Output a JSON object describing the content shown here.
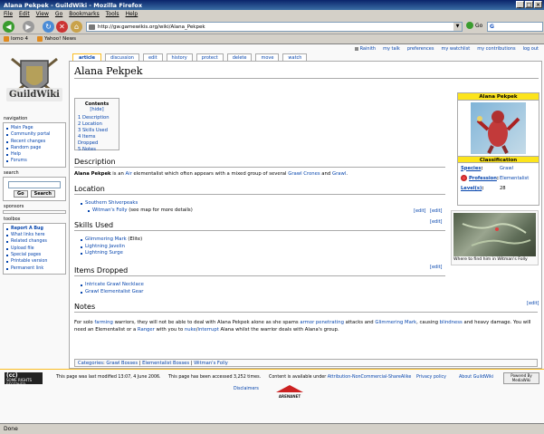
{
  "window": {
    "title": "Alana Pekpek - GuildWiki - Mozilla Firefox"
  },
  "menu": [
    "File",
    "Edit",
    "View",
    "Go",
    "Bookmarks",
    "Tools",
    "Help"
  ],
  "nav": {
    "url": "http://gw.gamewikis.org/wiki/Alana_Pekpek",
    "go_label": "Go",
    "search_placeholder": "G"
  },
  "bookmarks": [
    "Iomo 4",
    "Yahoo! News"
  ],
  "personal": [
    "Rainith",
    "my talk",
    "preferences",
    "my watchlist",
    "my contributions",
    "log out"
  ],
  "logo_text": "GuildWiki",
  "tabs": [
    "article",
    "discussion",
    "edit",
    "history",
    "protect",
    "delete",
    "move",
    "watch"
  ],
  "sidebar": {
    "navigation_title": "navigation",
    "navigation": [
      "Main Page",
      "Community portal",
      "Recent changes",
      "Random page",
      "Help",
      "Forums"
    ],
    "search_title": "search",
    "search_go": "Go",
    "search_search": "Search",
    "sponsors_title": "sponsors",
    "toolbox_title": "toolbox",
    "toolbox": [
      "Report A Bug",
      "What links here",
      "Related changes",
      "Upload file",
      "Special pages",
      "Printable version",
      "Permanent link"
    ]
  },
  "article": {
    "title": "Alana Pekpek",
    "toc": {
      "title": "Contents",
      "hide": "[hide]",
      "items": [
        "1 Description",
        "2 Location",
        "3 Skills Used",
        "4 Items Dropped",
        "5 Notes"
      ]
    },
    "edit_label": "[edit]",
    "description": {
      "heading": "Description",
      "name": "Alana Pekpek",
      "t1": " is an ",
      "l1": "Air",
      "t2": " elementalist which often appears with a mixed group of several ",
      "l2": "Grawl Crones",
      "t3": " and ",
      "l3": "Grawl",
      "t4": "."
    },
    "location": {
      "heading": "Location",
      "items": [
        "Southern Shiverpeaks"
      ],
      "sub_link": "Witman's Folly",
      "sub_text": " (see map for more details)"
    },
    "skills": {
      "heading": "Skills Used",
      "items": [
        {
          "link": "Glimmering Mark",
          "suffix": " (Elite)"
        },
        {
          "link": "Lightning Javelin",
          "suffix": ""
        },
        {
          "link": "Lightning Surge",
          "suffix": ""
        }
      ]
    },
    "items": {
      "heading": "Items Dropped",
      "items": [
        "Intricate Grawl Necklace",
        "Grawl Elementalist Gear"
      ]
    },
    "notes": {
      "heading": "Notes",
      "p1": "For solo ",
      "l1": "farming",
      "p2": " warriors, they will not be able to deal with Alana Pekpek alone as she spams ",
      "l2": "armor penetrating",
      "p3": " attacks and ",
      "l3": "Glimmering Mark",
      "p4": ", causing ",
      "l4": "blindness",
      "p5": " and heavy damage. You will need an Elementalist or a ",
      "l5": "Ranger",
      "p6": " with you to ",
      "l6": "nuke",
      "p7": "/",
      "l7": "interrupt",
      "p8": " Alana whilst the warrior deals with Alana's group."
    },
    "categories": {
      "label": "Categories",
      "items": [
        "Grawl Bosses",
        "Elementalist Bosses",
        "Witman's Folly"
      ]
    }
  },
  "infobox": {
    "name": "Alana Pekpek",
    "classification": "Classification",
    "species_label": "Species",
    "species": "Grawl",
    "profession_label": "Profession",
    "profession": "Elementalist",
    "level_label": "Level(s)",
    "level": "28",
    "map_caption": "Where to find him in Witman's Folly"
  },
  "footer": {
    "cc": "SOME RIGHTS RESERVED",
    "modified": "This page was last modified 13:07, 4 June 2006.",
    "accessed": "This page has been accessed 3,252 times.",
    "content_pre": "Content is available under ",
    "license": "Attribution-NonCommercial-ShareAlike",
    "privacy": "Privacy policy",
    "about": "About GuildWiki",
    "disclaimers": "Disclaimers",
    "anet": "ARENANET",
    "mediawiki": "Powered By MediaWiki"
  },
  "status": "Done"
}
